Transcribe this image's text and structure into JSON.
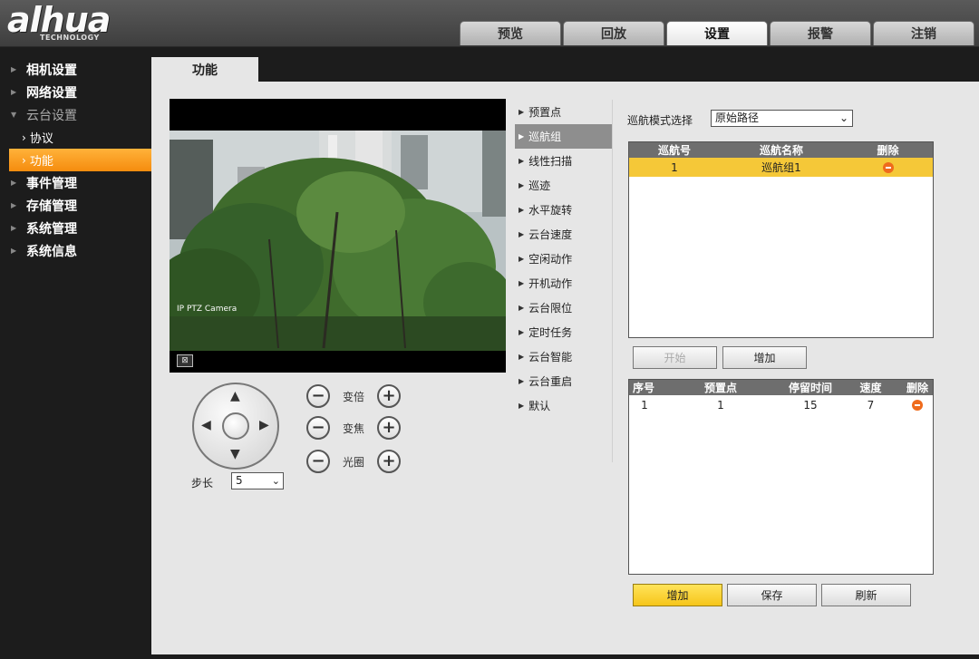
{
  "logo": {
    "mark": "alhua",
    "sub": "TECHNOLOGY"
  },
  "top_nav": [
    {
      "label": "预览"
    },
    {
      "label": "回放"
    },
    {
      "label": "设置",
      "active": true
    },
    {
      "label": "报警"
    },
    {
      "label": "注销"
    }
  ],
  "sidebar": {
    "items": [
      {
        "label": "相机设置"
      },
      {
        "label": "网络设置"
      },
      {
        "label": "云台设置"
      },
      {
        "label": "协议"
      },
      {
        "label": "功能"
      },
      {
        "label": "事件管理"
      },
      {
        "label": "存储管理"
      },
      {
        "label": "系统管理"
      },
      {
        "label": "系统信息"
      }
    ]
  },
  "page_tab": "功能",
  "video": {
    "osd": "IP PTZ Camera",
    "fullscreen_glyph": "⊠"
  },
  "ptz": {
    "zoom_label": "变倍",
    "focus_label": "变焦",
    "iris_label": "光圈",
    "minus": "−",
    "plus": "+",
    "step_label": "步长",
    "step_value": "5"
  },
  "menu": [
    {
      "label": "预置点"
    },
    {
      "label": "巡航组",
      "active": true
    },
    {
      "label": "线性扫描"
    },
    {
      "label": "巡迹"
    },
    {
      "label": "水平旋转"
    },
    {
      "label": "云台速度"
    },
    {
      "label": "空闲动作"
    },
    {
      "label": "开机动作"
    },
    {
      "label": "云台限位"
    },
    {
      "label": "定时任务"
    },
    {
      "label": "云台智能"
    },
    {
      "label": "云台重启"
    },
    {
      "label": "默认"
    }
  ],
  "tour": {
    "mode_label": "巡航模式选择",
    "mode_value": "原始路径",
    "groups_table": {
      "headers": [
        "巡航号",
        "巡航名称",
        "删除"
      ],
      "rows": [
        {
          "no": "1",
          "name": "巡航组1"
        }
      ]
    },
    "start_button": "开始",
    "add_group_button": "增加",
    "points_table": {
      "headers": [
        "序号",
        "预置点",
        "停留时间",
        "速度",
        "删除"
      ],
      "rows": [
        {
          "index": "1",
          "preset": "1",
          "dwell": "15",
          "speed": "7"
        }
      ]
    },
    "add_button": "增加",
    "save_button": "保存",
    "refresh_button": "刷新"
  },
  "colors": {
    "accent_orange": "#f58c0e",
    "selected_row": "#f5c838",
    "primary_button": "#f6c51a",
    "delete_icon": "#ef6b1c"
  }
}
